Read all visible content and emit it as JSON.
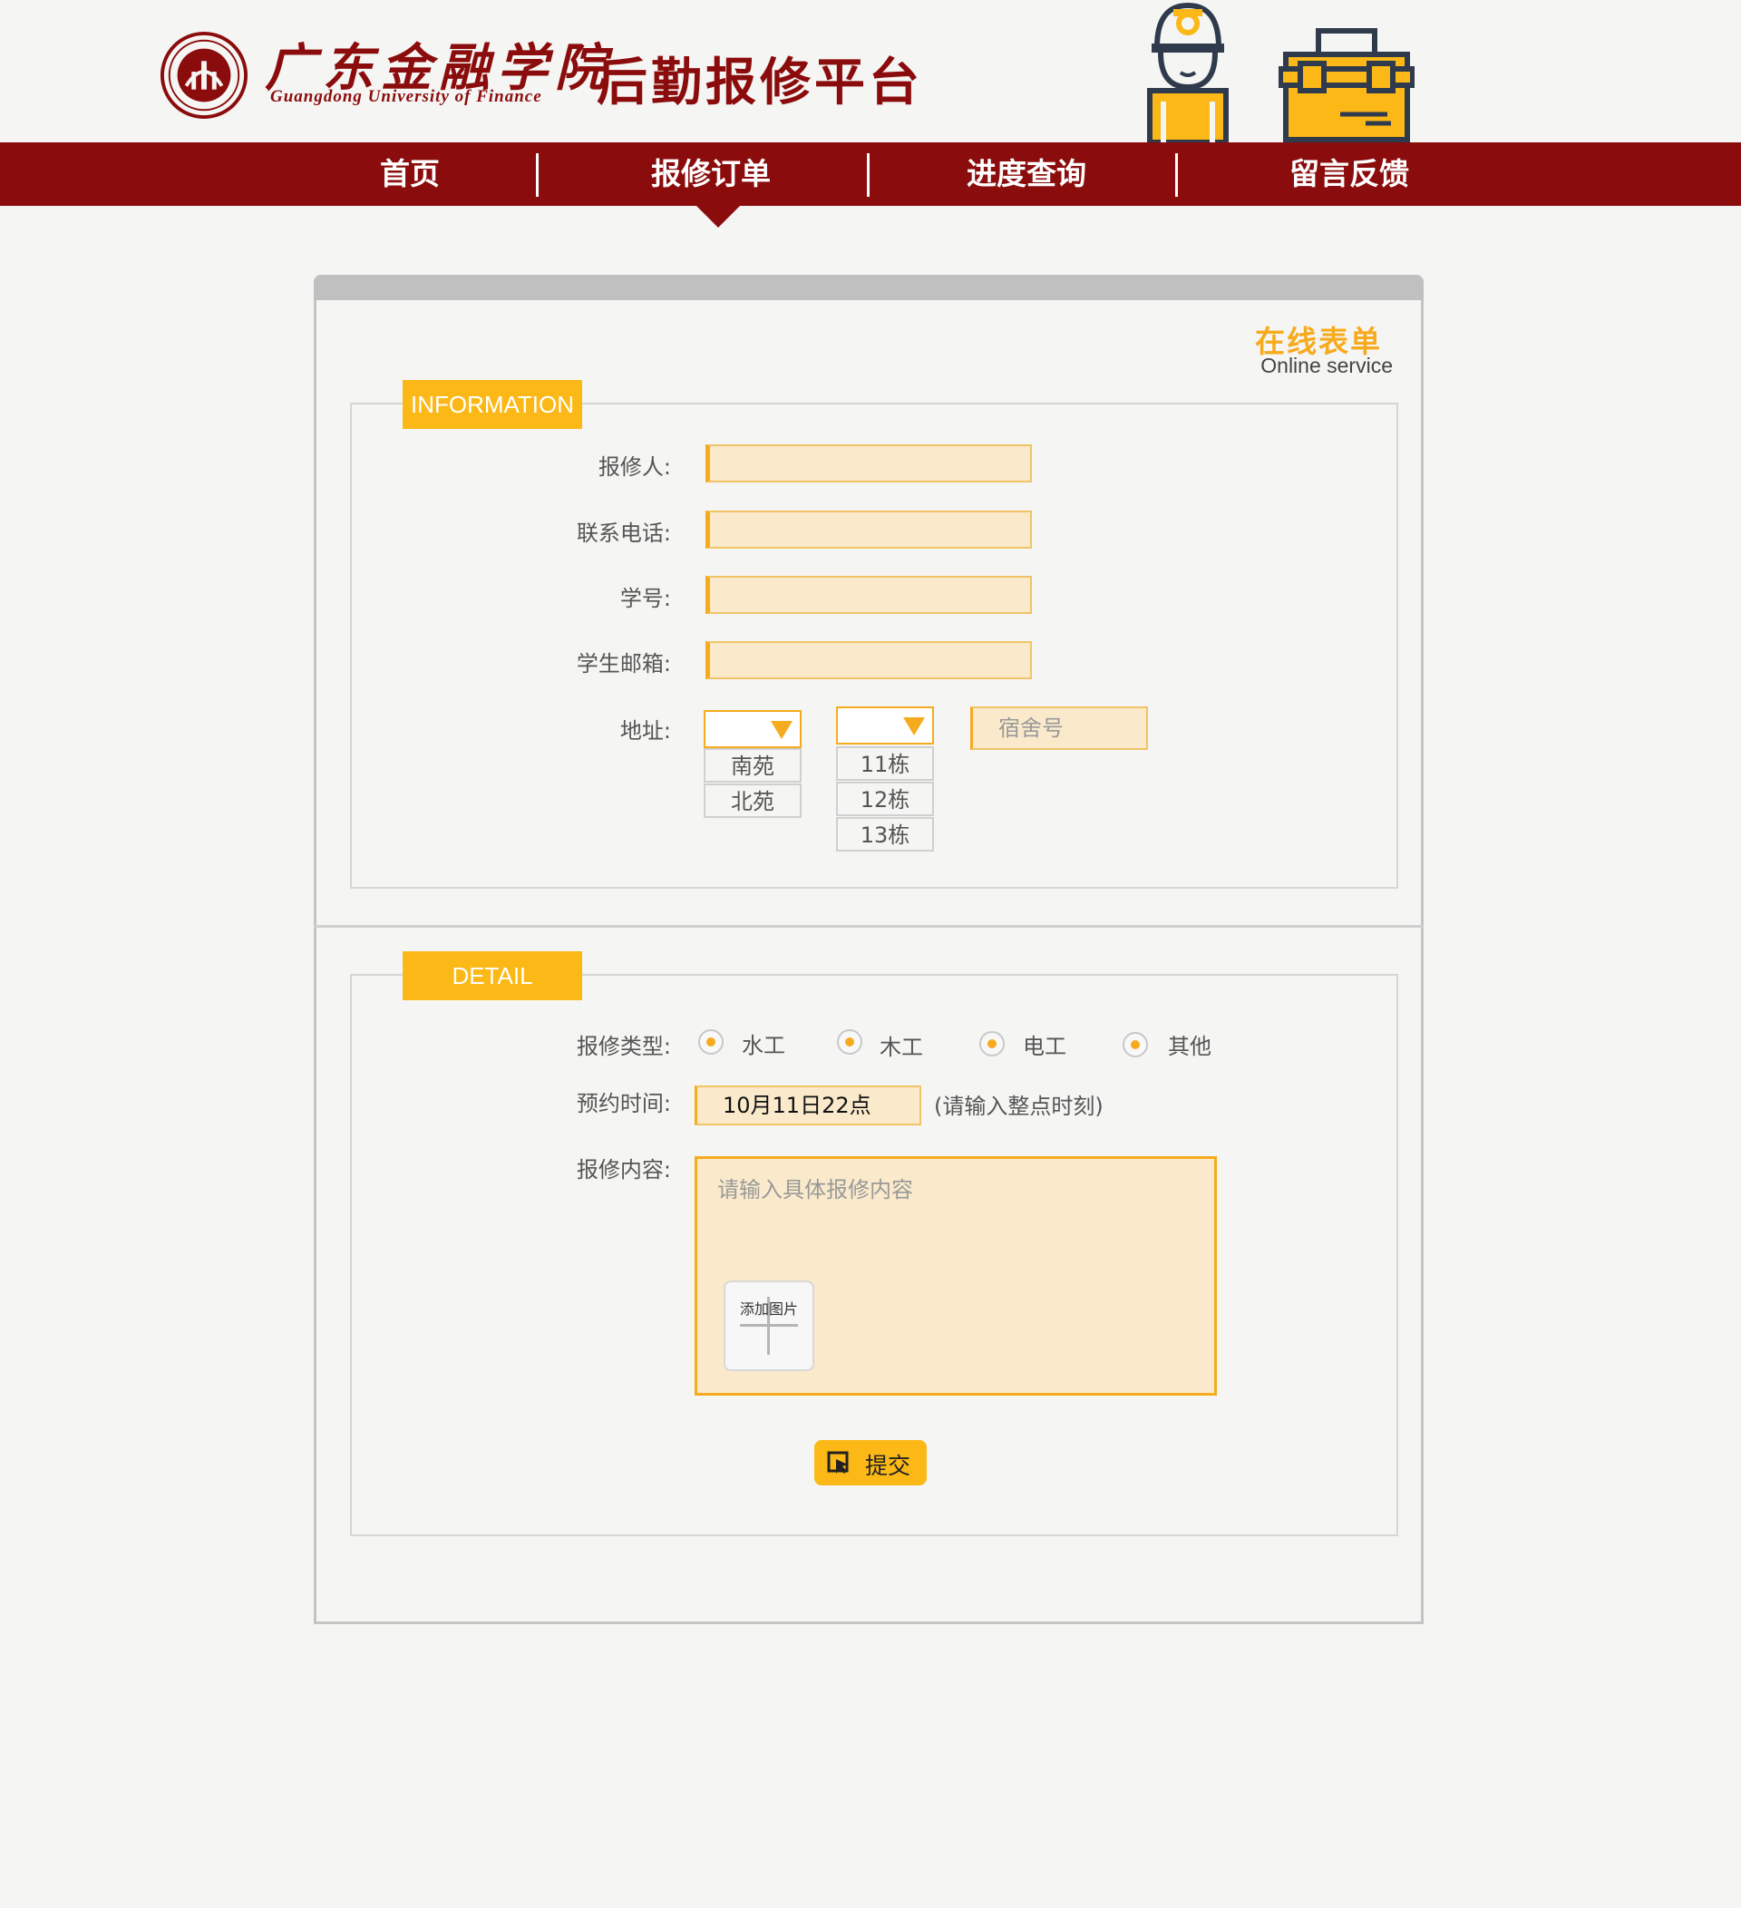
{
  "header": {
    "school_name_cn": "广东金融学院",
    "school_name_en": "Guangdong University of Finance",
    "platform_title": "后勤报修平台"
  },
  "nav": {
    "items": [
      "首页",
      "报修订单",
      "进度查询",
      "留言反馈"
    ],
    "active": "报修订单"
  },
  "form": {
    "heading_cn": "在线表单",
    "heading_en": "Online service",
    "information": {
      "tag": "INFORMATION",
      "reporter_label": "报修人:",
      "phone_label": "联系电话:",
      "student_id_label": "学号:",
      "email_label": "学生邮箱:",
      "address_label": "地址:",
      "campus_options": [
        "南苑",
        "北苑"
      ],
      "building_options": [
        "11栋",
        "12栋",
        "13栋"
      ],
      "dorm_placeholder": "宿舍号"
    },
    "detail": {
      "tag": "DETAIL",
      "type_label": "报修类型:",
      "types": [
        "水工",
        "木工",
        "电工",
        "其他"
      ],
      "time_label": "预约时间:",
      "time_value": "10月11日22点",
      "time_hint": "(请输入整点时刻)",
      "content_label": "报修内容:",
      "content_placeholder": "请输入具体报修内容",
      "add_photo_label": "添加图片",
      "submit_label": "提交"
    }
  },
  "colors": {
    "brand_red": "#8b0c0c",
    "accent_yellow": "#fbb817",
    "input_fill": "#faeacb",
    "page_bg": "#f5f5f3"
  },
  "icons": [
    "university-seal-icon",
    "repair-worker-icon",
    "toolbox-icon",
    "dropdown-arrow-icon",
    "submit-cursor-icon",
    "plus-icon"
  ]
}
